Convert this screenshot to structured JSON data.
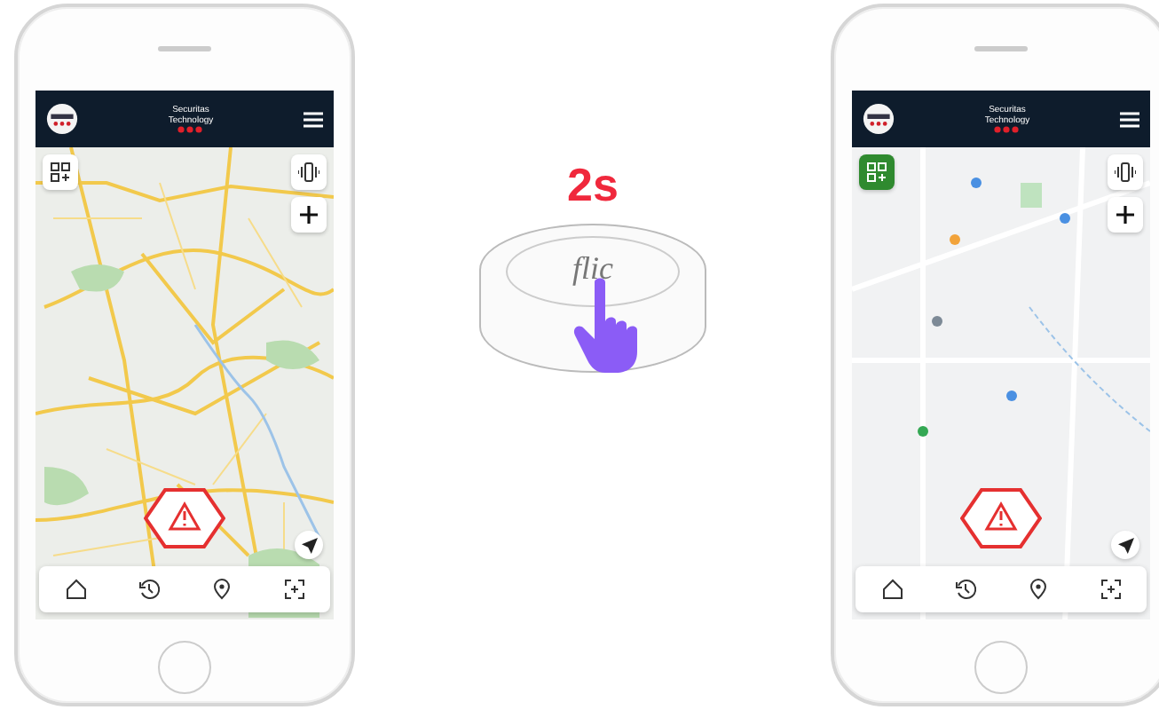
{
  "phones": [
    {
      "brand_line1": "Securitas",
      "brand_line2": "Technology",
      "kind": "city",
      "grid_button_active": false
    },
    {
      "brand_line1": "Securitas",
      "brand_line2": "Technology",
      "kind": "rural",
      "grid_button_active": true
    }
  ],
  "button_illustration": {
    "hold_time": "2s",
    "logo": "flic"
  }
}
